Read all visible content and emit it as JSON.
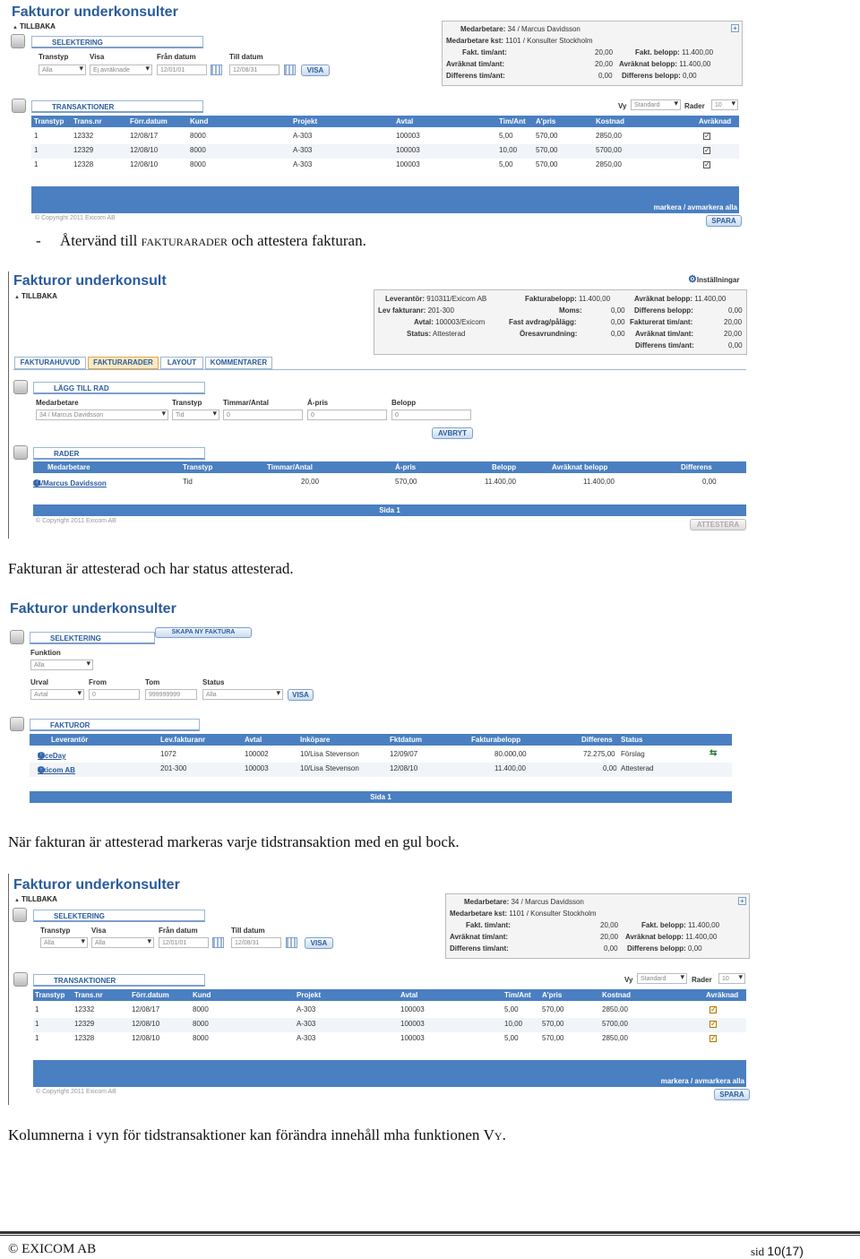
{
  "s1": {
    "title": "Fakturor underkonsulter",
    "back": "TILLBAKA",
    "sel_header": "SELEKTERING",
    "filters": {
      "transtyp_label": "Transtyp",
      "transtyp": "Alla",
      "visa_label": "Visa",
      "visa": "Ej avräknade",
      "fran_label": "Från datum",
      "fran": "12/01/01",
      "till_label": "Till datum",
      "till": "12/08/31",
      "visa_btn": "VISA"
    },
    "info": [
      [
        "Medarbetare:",
        "34 / Marcus Davidsson"
      ],
      [
        "Medarbetare kst:",
        "1101 / Konsulter Stockholm"
      ],
      [
        "Fakt. tim/ant:",
        "20,00",
        "Fakt. belopp:",
        "11.400,00"
      ],
      [
        "Avräknat tim/ant:",
        "20,00",
        "Avräknat belopp:",
        "11.400,00"
      ],
      [
        "Differens tim/ant:",
        "0,00",
        "Differens belopp:",
        "0,00"
      ]
    ],
    "trans_header": "TRANSAKTIONER",
    "vy_label": "Vy",
    "vy": "Standard",
    "rader_label": "Rader",
    "rader": "10",
    "cols": [
      "Transtyp",
      "Trans.nr",
      "Förr.datum",
      "Kund",
      "Projekt",
      "Avtal",
      "Tim/Ant",
      "A'pris",
      "Kostnad",
      "Avräknad"
    ],
    "rows": [
      [
        "1",
        "12332",
        "12/08/17",
        "8000",
        "A-303",
        "100003",
        "5,00",
        "570,00",
        "2850,00"
      ],
      [
        "1",
        "12329",
        "12/08/10",
        "8000",
        "A-303",
        "100003",
        "10,00",
        "570,00",
        "5700,00"
      ],
      [
        "1",
        "12328",
        "12/08/10",
        "8000",
        "A-303",
        "100003",
        "5,00",
        "570,00",
        "2850,00"
      ]
    ],
    "markera": "markera / avmarkera alla",
    "copyright": "© Copyright 2011 Exicom AB",
    "spara": "SPARA"
  },
  "p1": {
    "dash": "-",
    "text": "Återvänd till ",
    "sc": "fakturarader",
    "text2": " och attestera fakturan."
  },
  "s2": {
    "title": "Fakturor underkonsult",
    "back": "TILLBAKA",
    "settings": "Inställningar",
    "info": [
      [
        "Leverantör:",
        "910311/Exicom AB",
        "Fakturabelopp:",
        "11.400,00",
        "Avräknat belopp:",
        "11.400,00"
      ],
      [
        "Lev fakturanr:",
        "201-300",
        "Moms:",
        "0,00",
        "Differens belopp:",
        "0,00"
      ],
      [
        "Avtal:",
        "100003/Exicom",
        "Fast avdrag/pålägg:",
        "0,00",
        "Fakturerat tim/ant:",
        "20,00"
      ],
      [
        "Status:",
        "Attesterad",
        "Öresavrundning:",
        "0,00",
        "Avräknat tim/ant:",
        "20,00"
      ],
      [
        "",
        "",
        "",
        "",
        "Differens tim/ant:",
        "0,00"
      ]
    ],
    "tabs": [
      "FAKTURAHUVUD",
      "FAKTURARADER",
      "LAYOUT",
      "KOMMENTARER"
    ],
    "add_header": "LÄGG TILL RAD",
    "add": {
      "med_label": "Medarbetare",
      "med": "34 / Marcus Davidsson",
      "transtyp_label": "Transtyp",
      "transtyp": "Tid",
      "tim_label": "Timmar/Antal",
      "tim": "0",
      "apris_label": "Á-pris",
      "apris": "0",
      "belopp_label": "Belopp",
      "belopp": "0",
      "avbryt": "AVBRYT"
    },
    "rader_header": "RADER",
    "cols": [
      "Medarbetare",
      "Transtyp",
      "Timmar/Antal",
      "Á-pris",
      "Belopp",
      "Avräknat belopp",
      "Differens"
    ],
    "row": [
      "34/Marcus Davidsson",
      "Tid",
      "20,00",
      "570,00",
      "11.400,00",
      "11.400,00",
      "0,00"
    ],
    "sida": "Sida 1",
    "copyright": "© Copyright 2011 Exicom AB",
    "attestera": "ATTESTERA"
  },
  "p2": {
    "text": "Fakturan är attesterad och har status attesterad."
  },
  "s3": {
    "title": "Fakturor underkonsulter",
    "sel_header": "SELEKTERING",
    "skapa": "SKAPA NY FAKTURA",
    "funktion_label": "Funktion",
    "funktion": "Alla",
    "urval_label": "Urval",
    "urval": "Avtal",
    "from_label": "From",
    "from": "0",
    "tom_label": "Tom",
    "tom": "999999999",
    "status_label": "Status",
    "status": "Alla",
    "visa_btn": "VISA",
    "fakturor_header": "FAKTUROR",
    "cols": [
      "Leverantör",
      "Lev.fakturanr",
      "Avtal",
      "Inköpare",
      "Fktdatum",
      "Fakturabelopp",
      "Differens",
      "Status"
    ],
    "rows": [
      [
        "NiceDay",
        "1072",
        "100002",
        "10/Lisa Stevenson",
        "12/09/07",
        "80.000,00",
        "72.275,00",
        "Förslag"
      ],
      [
        "Exicom AB",
        "201-300",
        "100003",
        "10/Lisa Stevenson",
        "12/08/10",
        "11.400,00",
        "0,00",
        "Attesterad"
      ]
    ],
    "sida": "Sida 1"
  },
  "p3": {
    "text": "När fakturan är attesterad markeras varje tidstransaktion med en gul bock."
  },
  "p4": {
    "text": "Kolumnerna i vyn för tidstransaktioner kan förändra innehåll mha funktionen ",
    "sc": "Vy",
    "end": "."
  },
  "footer": {
    "left": "© EXICOM AB",
    "sid": "sid",
    "page": "10(17)"
  }
}
